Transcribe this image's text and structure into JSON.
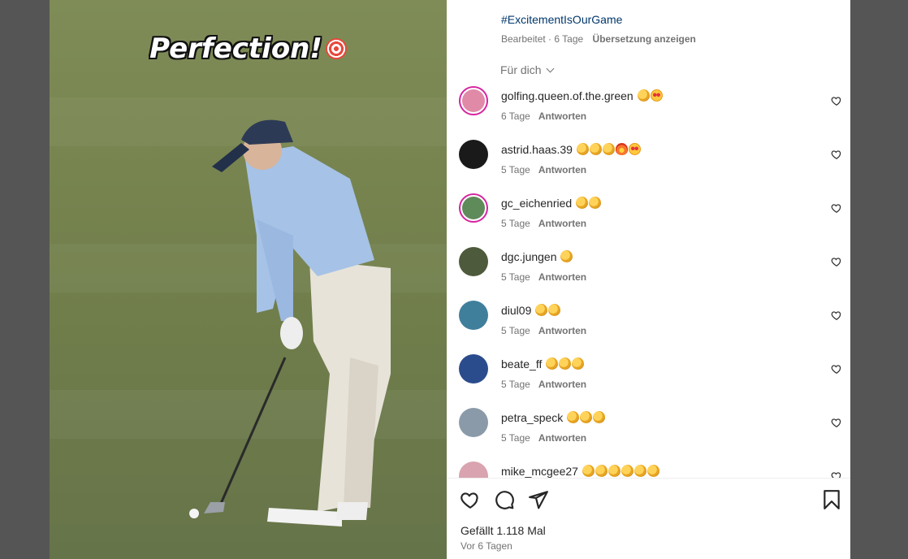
{
  "media": {
    "caption_text": "Perfection!",
    "caption_emoji": "target-emoji"
  },
  "post": {
    "hashtag": "#ExcitementIsOurGame",
    "edited_label": "Bearbeitet",
    "age": "6 Tage",
    "translate_label": "Übersetzung anzeigen",
    "sort_label": "Für dich"
  },
  "comments": [
    {
      "user": "golfing.queen.of.the.green",
      "emojis": [
        "clap",
        "stareyes"
      ],
      "age": "6 Tage",
      "reply": "Antworten",
      "avatar_color": "#e08aa8",
      "ring": true
    },
    {
      "user": "astrid.haas.39",
      "emojis": [
        "clap",
        "clap",
        "clap",
        "fire",
        "stareyes"
      ],
      "age": "5 Tage",
      "reply": "Antworten",
      "avatar_color": "#1a1a1a",
      "ring": false
    },
    {
      "user": "gc_eichenried",
      "emojis": [
        "clap",
        "clap"
      ],
      "age": "5 Tage",
      "reply": "Antworten",
      "avatar_color": "#5f8a5a",
      "ring": true
    },
    {
      "user": "dgc.jungen",
      "emojis": [
        "clap"
      ],
      "age": "5 Tage",
      "reply": "Antworten",
      "avatar_color": "#4e5a3c",
      "ring": false
    },
    {
      "user": "diul09",
      "emojis": [
        "clap",
        "clap"
      ],
      "age": "5 Tage",
      "reply": "Antworten",
      "avatar_color": "#3f7f9c",
      "ring": false
    },
    {
      "user": "beate_ff",
      "emojis": [
        "clap",
        "clap",
        "clap"
      ],
      "age": "5 Tage",
      "reply": "Antworten",
      "avatar_color": "#2b4c8c",
      "ring": false
    },
    {
      "user": "petra_speck",
      "emojis": [
        "clap",
        "clap",
        "clap"
      ],
      "age": "5 Tage",
      "reply": "Antworten",
      "avatar_color": "#8a9aa8",
      "ring": false
    },
    {
      "user": "mike_mcgee27",
      "emojis": [
        "clap",
        "clap",
        "clap",
        "clap",
        "clap",
        "clap"
      ],
      "age": "",
      "reply": "",
      "avatar_color": "#d9a3b0",
      "ring": false
    }
  ],
  "footer": {
    "likes_text": "Gefällt 1.118 Mal",
    "date_text": "Vor 6 Tagen"
  }
}
